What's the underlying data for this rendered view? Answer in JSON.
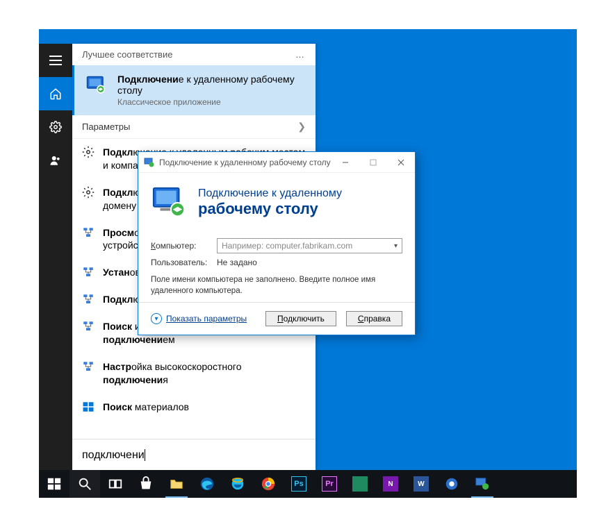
{
  "start": {
    "header": "Лучшее соответствие",
    "more": "…",
    "bestMatch": {
      "title_pre": "Подключени",
      "title_post": "е к удаленному рабочему столу",
      "subtitle": "Классическое приложение"
    },
    "paramsSection": "Параметры",
    "results": [
      {
        "pre": "Подкл",
        "rest": "ючение к удаленным рабочим местам и компаниям"
      },
      {
        "pre": "Подкл",
        "rest": "ючение к рабочей области или домену"
      },
      {
        "pre": "Просм",
        "rest": "отр сетевых компьютеров и устройств"
      },
      {
        "pre": "Устан",
        "rest": "овление удаленного подключения"
      },
      {
        "pre": "Подкл",
        "rest": "ючение к удаленному рабочему столу"
      },
      {
        "pre": "Поиск",
        "rest": " и устранение проблем с сетью и ",
        "tail_bold": "подключени",
        "tail_rest": "ем"
      },
      {
        "pre": "Настр",
        "rest": "ойка высокоскоростного ",
        "tail_bold": "подключени",
        "tail_rest": "я"
      },
      {
        "pre": "Поиск",
        "rest": " материалов"
      }
    ],
    "searchValue": "подключени"
  },
  "rdp": {
    "title": "Подключение к удаленному рабочему столу",
    "bannerLine1": "Подключение к удаленному",
    "bannerLine2": "рабочему столу",
    "computerLabel": "Компьютер:",
    "computerPlaceholder": "Например: computer.fabrikam.com",
    "userLabel": "Пользователь:",
    "userValue": "Не задано",
    "hint": "Поле имени компьютера не заполнено. Введите полное имя удаленного компьютера.",
    "showOptions": "Показать параметры",
    "connectBtn": "Подключить",
    "helpBtn": "Справка"
  }
}
